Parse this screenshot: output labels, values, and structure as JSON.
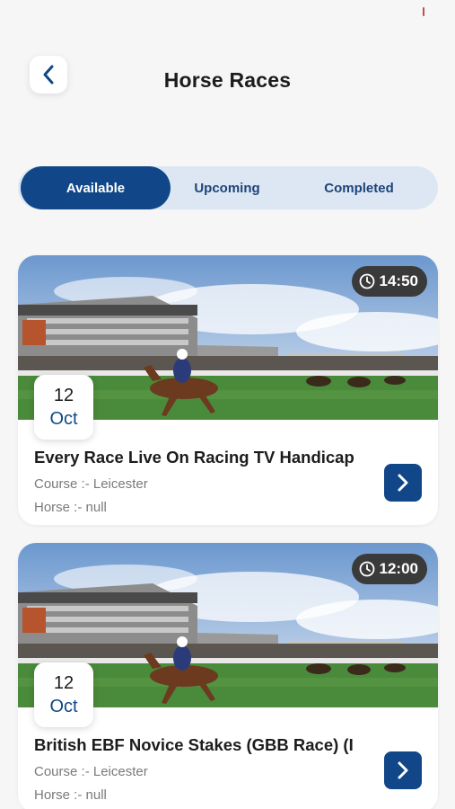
{
  "header": {
    "title": "Horse Races",
    "back_icon": "chevron-left-icon"
  },
  "tabs": [
    {
      "label": "Available",
      "active": true
    },
    {
      "label": "Upcoming",
      "active": false
    },
    {
      "label": "Completed",
      "active": false
    }
  ],
  "races": [
    {
      "time": "14:50",
      "day": "12",
      "month": "Oct",
      "title": "Every Race Live On Racing TV Handicap",
      "course": "Course :- Leicester",
      "horse": "Horse :- null"
    },
    {
      "time": "12:00",
      "day": "12",
      "month": "Oct",
      "title": "British EBF Novice Stakes (GBB Race) (I",
      "course": "Course :- Leicester",
      "horse": "Horse :- null"
    }
  ],
  "colors": {
    "primary": "#114788",
    "tab_track": "#dde7f3",
    "badge": "#3a3a3a",
    "background": "#f6f6f7"
  },
  "icons": {
    "time": "clock-icon",
    "open": "chevron-right-icon"
  }
}
